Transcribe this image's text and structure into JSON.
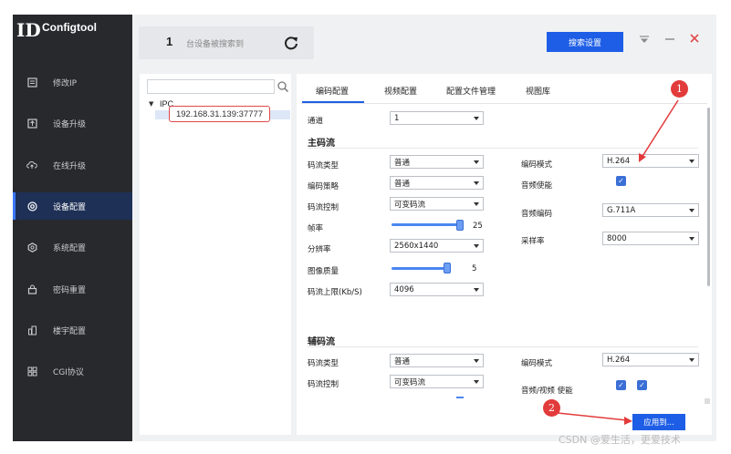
{
  "app": {
    "title": "Configtool",
    "logo_mark": "ID"
  },
  "sidebar": {
    "items": [
      {
        "label": "修改IP",
        "icon": "edit-icon"
      },
      {
        "label": "设备升级",
        "icon": "upgrade-icon"
      },
      {
        "label": "在线升级",
        "icon": "cloud-upload-icon"
      },
      {
        "label": "设备配置",
        "icon": "config-target-icon",
        "active": true
      },
      {
        "label": "系统配置",
        "icon": "hexagon-gear-icon"
      },
      {
        "label": "密码重置",
        "icon": "lock-icon"
      },
      {
        "label": "楼宇配置",
        "icon": "building-icon"
      },
      {
        "label": "CGI协议",
        "icon": "grid-icon"
      }
    ]
  },
  "header": {
    "device_count": "1",
    "device_count_label": "台设备被搜索到",
    "search_settings_button": "搜索设置"
  },
  "device_tree": {
    "search_placeholder": "",
    "root": "IPC",
    "device": "192.168.31.139:37777"
  },
  "tabs": [
    "编码配置",
    "视频配置",
    "配置文件管理",
    "视图库"
  ],
  "encode": {
    "channel_label": "通道",
    "channel_value": "1",
    "main_stream": {
      "title": "主码流",
      "stream_type_label": "码流类型",
      "stream_type": "普通",
      "strategy_label": "编码策略",
      "strategy": "普通",
      "bitrate_control_label": "码流控制",
      "bitrate_control": "可变码流",
      "framerate_label": "帧率",
      "framerate": "25",
      "resolution_label": "分辨率",
      "resolution": "2560x1440",
      "quality_label": "图像质量",
      "quality": "5",
      "bitrate_limit_label": "码流上限(Kb/S)",
      "bitrate_limit": "4096",
      "encode_mode_label": "编码模式",
      "encode_mode": "H.264",
      "audio_enable_label": "音频使能",
      "audio_enable": true,
      "audio_codec_label": "音频编码",
      "audio_codec": "G.711A",
      "sample_rate_label": "采样率",
      "sample_rate": "8000"
    },
    "sub_stream": {
      "title": "辅码流",
      "stream_type_label": "码流类型",
      "stream_type": "普通",
      "bitrate_control_label": "码流控制",
      "bitrate_control": "可变码流",
      "encode_mode_label": "编码模式",
      "encode_mode": "H.264",
      "av_enable_label": "音频/视频 使能",
      "audio_enable": true,
      "video_enable": true
    },
    "apply_button": "应用到..."
  },
  "annotations": {
    "marker1": "1",
    "marker2": "2"
  },
  "watermark": "CSDN @爱生活，更爱技术",
  "colors": {
    "accent": "#1e5ee6",
    "sidebar_bg": "#27292d",
    "highlight_red": "#e04a4a"
  }
}
